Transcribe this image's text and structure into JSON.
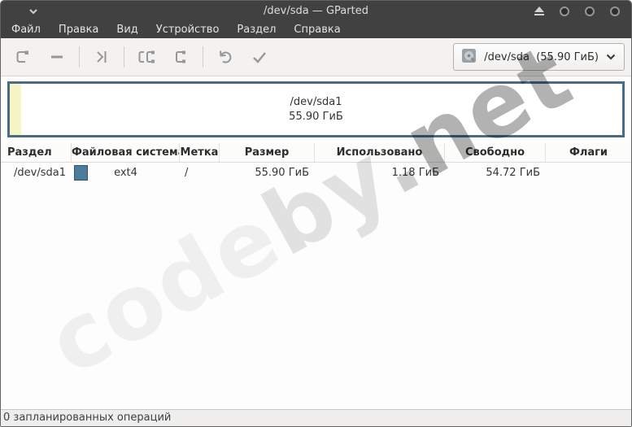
{
  "window": {
    "title": "/dev/sda — GParted"
  },
  "menubar": {
    "items": [
      "Файл",
      "Правка",
      "Вид",
      "Устройство",
      "Раздел",
      "Справка"
    ]
  },
  "toolbar": {
    "icons": [
      "new-partition",
      "delete-partition",
      "resize-move",
      "copy",
      "paste",
      "undo",
      "apply"
    ],
    "device_selector": {
      "label": "/dev/sda  (55.90 ГиБ)"
    }
  },
  "partition_visual": {
    "name": "/dev/sda1",
    "size": "55.90 ГиБ"
  },
  "table": {
    "columns": [
      "Раздел",
      "Файловая система",
      "Метка",
      "Размер",
      "Использовано",
      "Свободно",
      "Флаги"
    ],
    "rows": [
      {
        "partition": "/dev/sda1",
        "filesystem": "ext4",
        "fs_color": "#4d7b9a",
        "label": "/",
        "size": "55.90 ГиБ",
        "used": "1.18 ГиБ",
        "free": "54.72 ГиБ",
        "flags": ""
      }
    ]
  },
  "statusbar": {
    "text": "0 запланированных операций"
  },
  "watermark": {
    "text": "codeby.net",
    "seg1": "code",
    "seg2": "by",
    "seg3": ".",
    "seg4": "net"
  },
  "colors": {
    "titlebar_bg": "#414141",
    "partition_border": "#4a6a85",
    "used_strip": "#f6f6c5",
    "ext4_swatch": "#4d7b9a"
  }
}
